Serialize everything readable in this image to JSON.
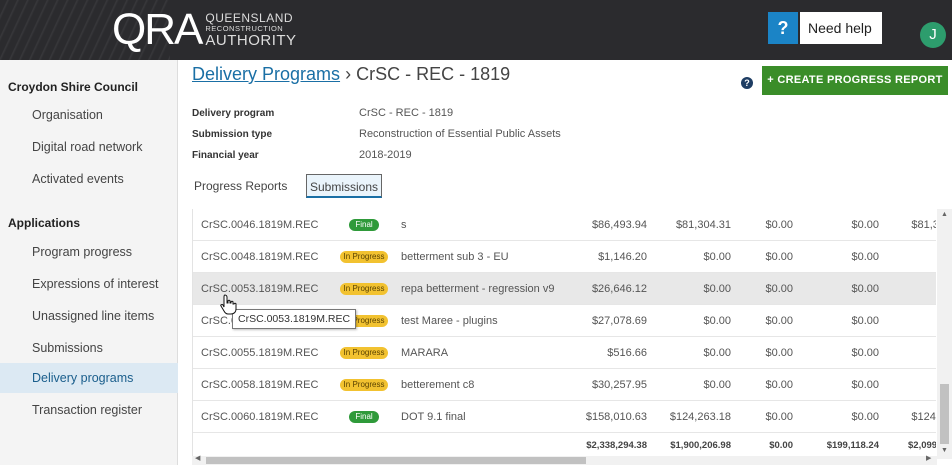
{
  "header": {
    "logo_mark": "QRA",
    "logo_line1": "QUEENSLAND",
    "logo_line2": "RECONSTRUCTION",
    "logo_line3": "AUTHORITY",
    "help_icon": "?",
    "help_label": "Need help",
    "avatar_initial": "J"
  },
  "sidebar": {
    "council_title": "Croydon Shire Council",
    "council_items": [
      {
        "label": "Organisation"
      },
      {
        "label": "Digital road network"
      },
      {
        "label": "Activated events"
      }
    ],
    "applications_title": "Applications",
    "application_items": [
      {
        "label": "Program progress"
      },
      {
        "label": "Expressions of interest"
      },
      {
        "label": "Unassigned line items"
      },
      {
        "label": "Submissions"
      },
      {
        "label": "Delivery programs"
      },
      {
        "label": "Transaction register"
      }
    ]
  },
  "breadcrumb": {
    "link": "Delivery Programs",
    "separator": "›",
    "current": "CrSC - REC - 1819"
  },
  "help_circle": "?",
  "create_button": "+ CREATE PROGRESS REPORT",
  "details": {
    "delivery_program_label": "Delivery program",
    "delivery_program_value": "CrSC - REC - 1819",
    "submission_type_label": "Submission type",
    "submission_type_value": "Reconstruction of Essential Public Assets",
    "financial_year_label": "Financial year",
    "financial_year_value": "2018-2019"
  },
  "tabs": {
    "progress_reports": "Progress Reports",
    "submissions": "Submissions"
  },
  "table": {
    "rows": [
      {
        "id": "CrSC.0046.1819M.REC",
        "status": "Final",
        "status_type": "final",
        "description": "s",
        "v1": "$86,493.94",
        "v2": "$81,304.31",
        "v3": "$0.00",
        "v4": "$0.00",
        "v5": "$81,30"
      },
      {
        "id": "CrSC.0048.1819M.REC",
        "status": "In Progress",
        "status_type": "progress",
        "description": "betterment sub 3 - EU",
        "v1": "$1,146.20",
        "v2": "$0.00",
        "v3": "$0.00",
        "v4": "$0.00",
        "v5": "$"
      },
      {
        "id": "CrSC.0053.1819M.REC",
        "status": "In Progress",
        "status_type": "progress",
        "description": "repa betterment - regression v9",
        "v1": "$26,646.12",
        "v2": "$0.00",
        "v3": "$0.00",
        "v4": "$0.00",
        "v5": "$"
      },
      {
        "id": "CrSC.0",
        "status": "In Progress",
        "status_type": "progress",
        "description": "test Maree - plugins",
        "v1": "$27,078.69",
        "v2": "$0.00",
        "v3": "$0.00",
        "v4": "$0.00",
        "v5": "$"
      },
      {
        "id": "CrSC.0055.1819M.REC",
        "status": "In Progress",
        "status_type": "progress",
        "description": "MARARA",
        "v1": "$516.66",
        "v2": "$0.00",
        "v3": "$0.00",
        "v4": "$0.00",
        "v5": "$"
      },
      {
        "id": "CrSC.0058.1819M.REC",
        "status": "In Progress",
        "status_type": "progress",
        "description": "betterement c8",
        "v1": "$30,257.95",
        "v2": "$0.00",
        "v3": "$0.00",
        "v4": "$0.00",
        "v5": "$"
      },
      {
        "id": "CrSC.0060.1819M.REC",
        "status": "Final",
        "status_type": "final",
        "description": "DOT 9.1 final",
        "v1": "$158,010.63",
        "v2": "$124,263.18",
        "v3": "$0.00",
        "v4": "$0.00",
        "v5": "$124,2"
      }
    ],
    "totals": {
      "v1": "$2,338,294.38",
      "v2": "$1,900,206.98",
      "v3": "$0.00",
      "v4": "$199,118.24",
      "v5": "$2,099,3"
    }
  },
  "tooltip": "CrSC.0053.1819M.REC",
  "colors": {
    "header_bg": "#2b2b2e",
    "link": "#1a6fa5",
    "create_button": "#3a8d29",
    "final_badge": "#2f9a3a",
    "progress_badge": "#f2c230",
    "active_nav": "#dce9f3"
  }
}
